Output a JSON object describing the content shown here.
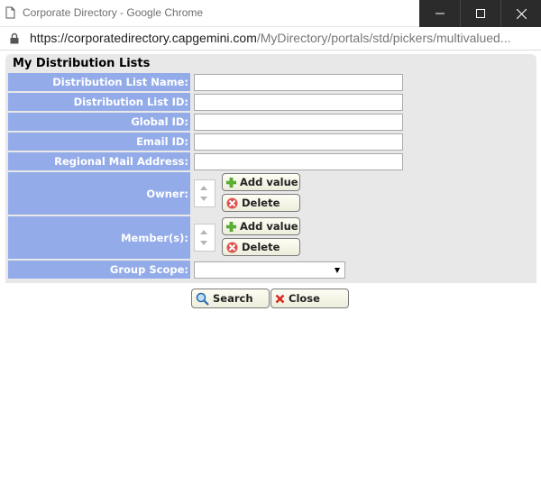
{
  "window": {
    "title": "Corporate Directory - Google Chrome"
  },
  "address": {
    "host": "https://corporatedirectory.capgemini.com",
    "path": "/MyDirectory/portals/std/pickers/multivalued..."
  },
  "form": {
    "title": "My Distribution Lists",
    "fields": {
      "dl_name": {
        "label": "Distribution List Name:",
        "value": ""
      },
      "dl_id": {
        "label": "Distribution List ID:",
        "value": ""
      },
      "global_id": {
        "label": "Global ID:",
        "value": ""
      },
      "email_id": {
        "label": "Email ID:",
        "value": ""
      },
      "regional_mail": {
        "label": "Regional Mail Address:",
        "value": ""
      },
      "owner": {
        "label": "Owner:",
        "add_label": "Add value",
        "delete_label": "Delete"
      },
      "members": {
        "label": "Member(s):",
        "add_label": "Add value",
        "delete_label": "Delete"
      },
      "group_scope": {
        "label": "Group Scope:",
        "selected": ""
      }
    }
  },
  "actions": {
    "search_label": "Search",
    "close_label": "Close"
  },
  "colors": {
    "label_bg": "#93abe9",
    "panel_bg": "#e8e8e8"
  }
}
